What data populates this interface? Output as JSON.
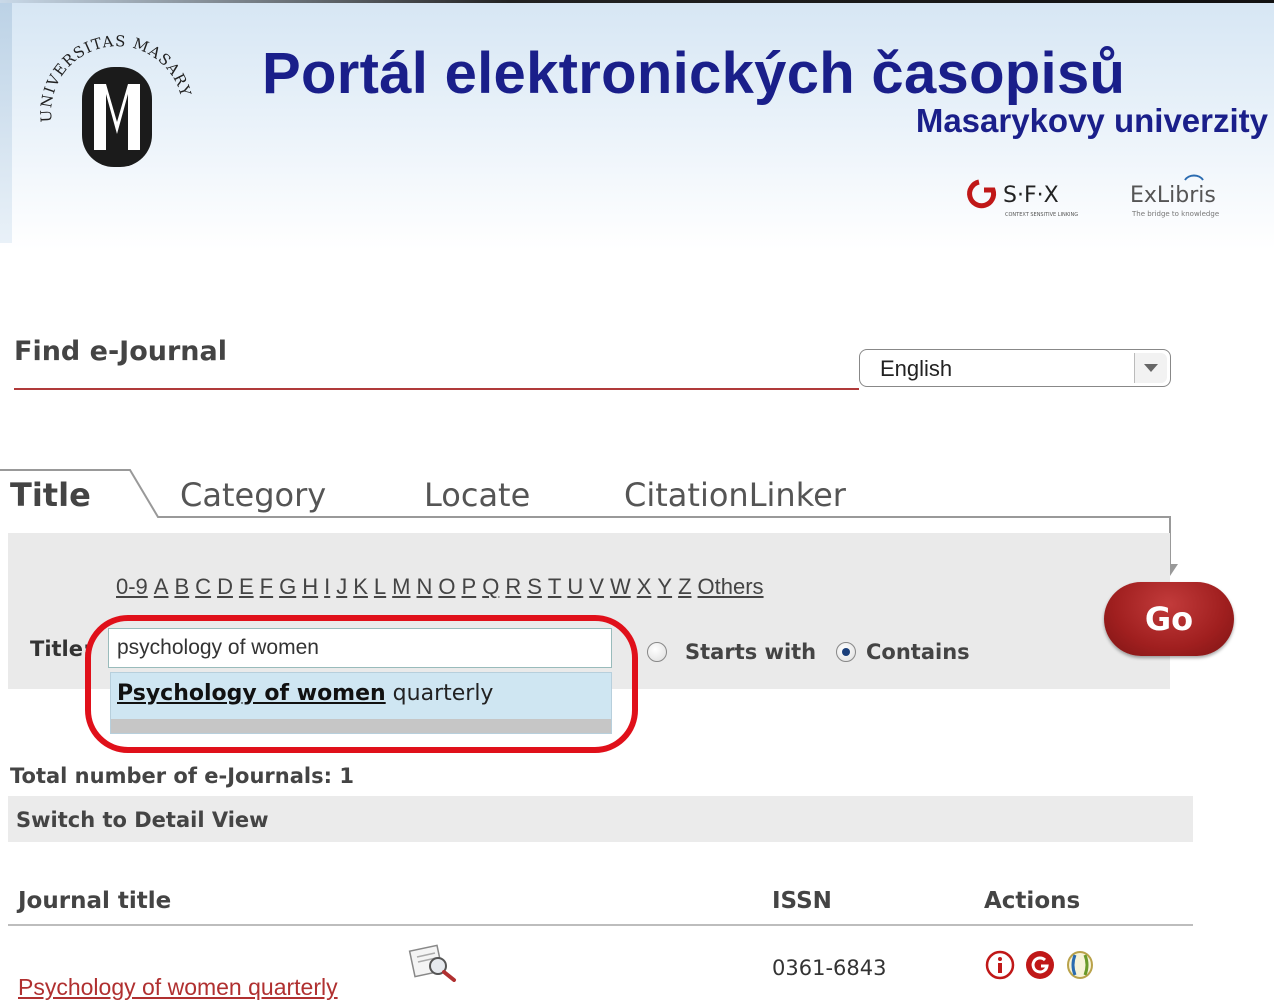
{
  "header": {
    "portal_title": "Portál elektronických časopisů",
    "portal_subtitle": "Masarykovy univerzity",
    "logo_text": "UNIVERSITAS MASARYKIANA BRUNENSIS",
    "sfx_logo": "S·F·X",
    "sfx_tagline": "CONTEXT SENSITIVE LINKING",
    "exlibris_logo": "ExLibris",
    "exlibris_tagline": "The bridge to knowledge"
  },
  "find": {
    "title": "Find e-Journal",
    "language_selected": "English"
  },
  "tabs": [
    {
      "label": "Title",
      "active": true
    },
    {
      "label": "Category",
      "active": false
    },
    {
      "label": "Locate",
      "active": false
    },
    {
      "label": "CitationLinker",
      "active": false
    }
  ],
  "search": {
    "alphabet": [
      "0-9",
      "A",
      "B",
      "C",
      "D",
      "E",
      "F",
      "G",
      "H",
      "I",
      "J",
      "K",
      "L",
      "M",
      "N",
      "O",
      "P",
      "Q",
      "R",
      "S",
      "T",
      "U",
      "V",
      "W",
      "X",
      "Y",
      "Z",
      "Others"
    ],
    "title_label": "Title:",
    "title_value": "psychology of women",
    "suggestion_match": "Psychology of women",
    "suggestion_rest": " quarterly",
    "starts_with_label": "Starts with",
    "contains_label": "Contains",
    "selected_mode": "Contains",
    "go_label": "Go"
  },
  "results": {
    "total_label": "Total number of e-Journals: 1",
    "switch_view_label": "Switch to Detail View",
    "columns": {
      "title": "Journal title",
      "issn": "ISSN",
      "actions": "Actions"
    },
    "rows": [
      {
        "title": "Psychology of women quarterly",
        "issn": "0361-6843",
        "actions": [
          "info-icon",
          "sfx-icon",
          "exlibris-icon"
        ]
      }
    ]
  },
  "colors": {
    "portal_title": "#1a1f8a",
    "accent_red": "#b03030",
    "go_button": "#a01f1f",
    "highlight_ring": "#e0101a"
  }
}
